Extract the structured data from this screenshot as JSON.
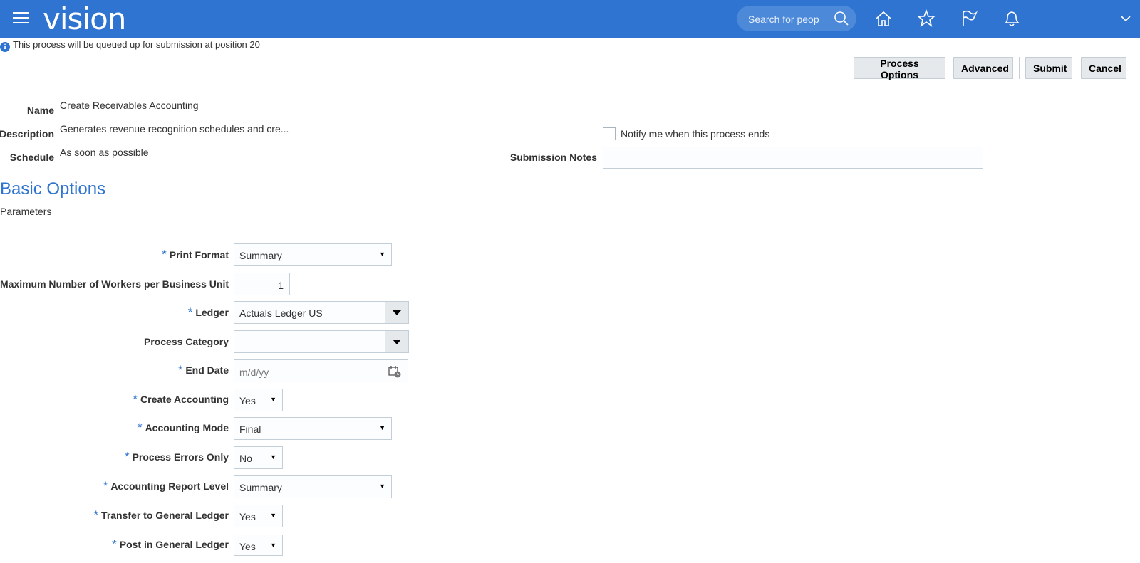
{
  "header": {
    "logo": "vision",
    "search_placeholder": "Search for people",
    "icons": [
      "menu-icon",
      "search-icon",
      "home-icon",
      "star-icon",
      "flag-icon",
      "bell-icon",
      "chevron-down-icon"
    ]
  },
  "info": {
    "message": "This process will be queued up for submission at position 20"
  },
  "buttons": {
    "process_options": "Process Options",
    "advanced": "Advanced",
    "submit": "Submit",
    "cancel": "Cancel"
  },
  "process": {
    "name_label": "Name",
    "name_value": "Create Receivables Accounting",
    "description_label": "Description",
    "description_value": "Generates revenue recognition schedules and cre...",
    "schedule_label": "Schedule",
    "schedule_value": "As soon as possible",
    "notify_label": "Notify me when this process ends",
    "notes_label": "Submission Notes",
    "notes_value": ""
  },
  "section": {
    "title": "Basic Options",
    "subtitle": "Parameters"
  },
  "params": {
    "print_format": {
      "label": "Print Format",
      "value": "Summary"
    },
    "max_workers": {
      "label": "Maximum Number of Workers per Business Unit",
      "value": "1"
    },
    "ledger": {
      "label": "Ledger",
      "value": "Actuals Ledger US"
    },
    "process_category": {
      "label": "Process Category",
      "value": ""
    },
    "end_date": {
      "label": "End Date",
      "placeholder": "m/d/yy"
    },
    "create_accounting": {
      "label": "Create Accounting",
      "value": "Yes"
    },
    "accounting_mode": {
      "label": "Accounting Mode",
      "value": "Final"
    },
    "process_errors_only": {
      "label": "Process Errors Only",
      "value": "No"
    },
    "report_level": {
      "label": "Accounting Report Level",
      "value": "Summary"
    },
    "transfer_gl": {
      "label": "Transfer to General Ledger",
      "value": "Yes"
    },
    "post_gl": {
      "label": "Post in General Ledger",
      "value": "Yes"
    }
  },
  "colors": {
    "header": "#2e74d0",
    "accent": "#2e74d0",
    "button_bg": "#e6e9ec"
  }
}
